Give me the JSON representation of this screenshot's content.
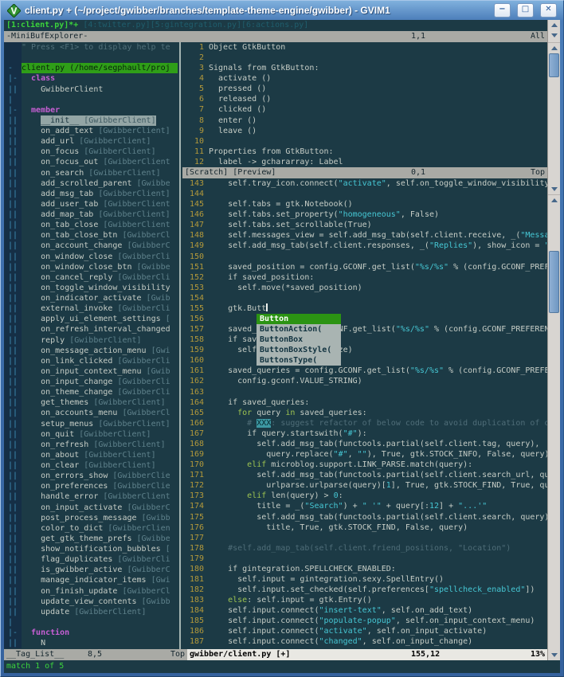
{
  "titlebar": {
    "title": "client.py + (~/project/gwibber/branches/template-theme-engine/gwibber) - GVIM1",
    "minimize": "−",
    "maximize": "□",
    "close": "✕"
  },
  "colors": {
    "titlebar_blue": "#3c6dab",
    "editor_bg": "#1c3a45",
    "string_cyan": "#46c7d4",
    "keyword_green": "#9dc351",
    "tag_keyword_magenta": "#c75fd4",
    "line_number_olive": "#b3993b",
    "file_highlight_green": "#2f9e18",
    "popup_selected_green": "#2b9313",
    "buffer_active_green": "#3bd33b",
    "match_message_green": "#3cd33c",
    "statusline_inactive": "#a9aaa5",
    "statusline_active": "#e9e8e3",
    "comment_dim": "#4f6d78",
    "todo_xxx_bg": "#3d98a3",
    "selected_tag_bg": "#93a5a5"
  },
  "minibuf": {
    "buffers_active": "[1:client.py]*+",
    "buffers_inactive": " [4:twitter.py][5:gintegration.py][6:actions.py]",
    "status_name": "-MiniBufExplorer-",
    "status_pos": "1,1",
    "status_scroll": "All"
  },
  "taglist": {
    "rows": [
      {
        "fold": "",
        "kind": "help",
        "text": "\" Press <F1> to display help te"
      },
      {
        "fold": "",
        "kind": "blank"
      },
      {
        "fold": "-",
        "kind": "file",
        "text": "client.py (/home/segphault/proj"
      },
      {
        "fold": "|-",
        "kind": "kw",
        "text": "  class"
      },
      {
        "fold": "||",
        "kind": "tag",
        "name": "GwibberClient",
        "suffix": ""
      },
      {
        "fold": "|",
        "kind": "blank"
      },
      {
        "fold": "|-",
        "kind": "kw",
        "text": "  member"
      },
      {
        "fold": "||",
        "kind": "sel",
        "name": "__init__",
        "suffix": " [GwibberClient]"
      },
      {
        "fold": "||",
        "kind": "tag",
        "name": "on_add_text",
        "suffix": " [GwibberClient]"
      },
      {
        "fold": "||",
        "kind": "tag",
        "name": "add_url",
        "suffix": " [GwibberClient]"
      },
      {
        "fold": "||",
        "kind": "tag",
        "name": "on_focus",
        "suffix": " [GwibberClient]"
      },
      {
        "fold": "||",
        "kind": "tag",
        "name": "on_focus_out",
        "suffix": " [GwibberClient"
      },
      {
        "fold": "||",
        "kind": "tag",
        "name": "on_search",
        "suffix": " [GwibberClient]"
      },
      {
        "fold": "||",
        "kind": "tag",
        "name": "add_scrolled_parent",
        "suffix": " [Gwibbe"
      },
      {
        "fold": "||",
        "kind": "tag",
        "name": "add_msg_tab",
        "suffix": " [GwibberClient]"
      },
      {
        "fold": "||",
        "kind": "tag",
        "name": "add_user_tab",
        "suffix": " [GwibberClient"
      },
      {
        "fold": "||",
        "kind": "tag",
        "name": "add_map_tab",
        "suffix": " [GwibberClient]"
      },
      {
        "fold": "||",
        "kind": "tag",
        "name": "on_tab_close",
        "suffix": " [GwibberClient"
      },
      {
        "fold": "||",
        "kind": "tag",
        "name": "on_tab_close_btn",
        "suffix": " [GwibberCl"
      },
      {
        "fold": "||",
        "kind": "tag",
        "name": "on_account_change",
        "suffix": " [GwibberC"
      },
      {
        "fold": "||",
        "kind": "tag",
        "name": "on_window_close",
        "suffix": " [GwibberCli"
      },
      {
        "fold": "||",
        "kind": "tag",
        "name": "on_window_close_btn",
        "suffix": " [Gwibbe"
      },
      {
        "fold": "||",
        "kind": "tag",
        "name": "on_cancel_reply",
        "suffix": " [GwibberCli"
      },
      {
        "fold": "||",
        "kind": "tag",
        "name": "on_toggle_window_visibility",
        "suffix": ""
      },
      {
        "fold": "||",
        "kind": "tag",
        "name": "on_indicator_activate",
        "suffix": " [Gwib"
      },
      {
        "fold": "||",
        "kind": "tag",
        "name": "external_invoke",
        "suffix": " [GwibberCli"
      },
      {
        "fold": "||",
        "kind": "tag",
        "name": "apply_ui_element_settings",
        "suffix": " ["
      },
      {
        "fold": "||",
        "kind": "tag",
        "name": "on_refresh_interval_changed",
        "suffix": ""
      },
      {
        "fold": "||",
        "kind": "tag",
        "name": "reply",
        "suffix": " [GwibberClient]"
      },
      {
        "fold": "||",
        "kind": "tag",
        "name": "on_message_action_menu",
        "suffix": " [Gwi"
      },
      {
        "fold": "||",
        "kind": "tag",
        "name": "on_link_clicked",
        "suffix": " [GwibberCli"
      },
      {
        "fold": "||",
        "kind": "tag",
        "name": "on_input_context_menu",
        "suffix": " [Gwib"
      },
      {
        "fold": "||",
        "kind": "tag",
        "name": "on_input_change",
        "suffix": " [GwibberCli"
      },
      {
        "fold": "||",
        "kind": "tag",
        "name": "on_theme_change",
        "suffix": " [GwibberCli"
      },
      {
        "fold": "||",
        "kind": "tag",
        "name": "get_themes",
        "suffix": " [GwibberClient]"
      },
      {
        "fold": "||",
        "kind": "tag",
        "name": "on_accounts_menu",
        "suffix": " [GwibberCl"
      },
      {
        "fold": "||",
        "kind": "tag",
        "name": "setup_menus",
        "suffix": " [GwibberClient]"
      },
      {
        "fold": "||",
        "kind": "tag",
        "name": "on_quit",
        "suffix": " [GwibberClient]"
      },
      {
        "fold": "||",
        "kind": "tag",
        "name": "on_refresh",
        "suffix": " [GwibberClient]"
      },
      {
        "fold": "||",
        "kind": "tag",
        "name": "on_about",
        "suffix": " [GwibberClient]"
      },
      {
        "fold": "||",
        "kind": "tag",
        "name": "on_clear",
        "suffix": " [GwibberClient]"
      },
      {
        "fold": "||",
        "kind": "tag",
        "name": "on_errors_show",
        "suffix": " [GwibberClie"
      },
      {
        "fold": "||",
        "kind": "tag",
        "name": "on_preferences",
        "suffix": " [GwibberClie"
      },
      {
        "fold": "||",
        "kind": "tag",
        "name": "handle_error",
        "suffix": " [GwibberClient"
      },
      {
        "fold": "||",
        "kind": "tag",
        "name": "on_input_activate",
        "suffix": " [GwibberC"
      },
      {
        "fold": "||",
        "kind": "tag",
        "name": "post_process_message",
        "suffix": " [Gwibb"
      },
      {
        "fold": "||",
        "kind": "tag",
        "name": "color_to_dict",
        "suffix": " [GwibberClien"
      },
      {
        "fold": "||",
        "kind": "tag",
        "name": "get_gtk_theme_prefs",
        "suffix": " [Gwibbe"
      },
      {
        "fold": "||",
        "kind": "tag",
        "name": "show_notification_bubbles",
        "suffix": " ["
      },
      {
        "fold": "||",
        "kind": "tag",
        "name": "flag_duplicates",
        "suffix": " [GwibberCli"
      },
      {
        "fold": "||",
        "kind": "tag",
        "name": "is_gwibber_active",
        "suffix": " [GwibberC"
      },
      {
        "fold": "||",
        "kind": "tag",
        "name": "manage_indicator_items",
        "suffix": " [Gwi"
      },
      {
        "fold": "||",
        "kind": "tag",
        "name": "on_finish_update",
        "suffix": " [GwibberCl"
      },
      {
        "fold": "||",
        "kind": "tag",
        "name": "update_view_contents",
        "suffix": " [Gwibb"
      },
      {
        "fold": "||",
        "kind": "tag",
        "name": "update",
        "suffix": " [GwibberClient]"
      },
      {
        "fold": "|",
        "kind": "blank"
      },
      {
        "fold": "|-",
        "kind": "kw",
        "text": "  function"
      },
      {
        "fold": "||",
        "kind": "tag",
        "name": "N",
        "suffix": ""
      }
    ],
    "status_name": "__Tag_List__",
    "status_pos": "8,5",
    "status_scroll": "Top"
  },
  "preview": {
    "lines": [
      {
        "n": "1",
        "text": "Object GtkButton"
      },
      {
        "n": "2",
        "text": ""
      },
      {
        "n": "3",
        "text": "Signals from GtkButton:"
      },
      {
        "n": "4",
        "text": "  activate ()"
      },
      {
        "n": "5",
        "text": "  pressed ()"
      },
      {
        "n": "6",
        "text": "  released ()"
      },
      {
        "n": "7",
        "text": "  clicked ()"
      },
      {
        "n": "8",
        "text": "  enter ()"
      },
      {
        "n": "9",
        "text": "  leave ()"
      },
      {
        "n": "10",
        "text": ""
      },
      {
        "n": "11",
        "text": "Properties from GtkButton:"
      },
      {
        "n": "12",
        "text": "  label -> gchararray: Label"
      }
    ],
    "status_name": "[Scratch] [Preview]",
    "status_pos": "0,1",
    "status_scroll": "Top"
  },
  "editor": {
    "lines": [
      {
        "n": "143",
        "segs": [
          [
            "    self.tray_icon.connect(",
            "n"
          ],
          [
            "\"activate\"",
            "s"
          ],
          [
            ", self.on_toggle_window_visibility",
            "n"
          ]
        ]
      },
      {
        "n": "144",
        "segs": []
      },
      {
        "n": "145",
        "segs": [
          [
            "    self.tabs = gtk.Notebook()",
            "n"
          ]
        ]
      },
      {
        "n": "146",
        "segs": [
          [
            "    self.tabs.set_property(",
            "n"
          ],
          [
            "\"homogeneous\"",
            "s"
          ],
          [
            ", False)",
            "n"
          ]
        ]
      },
      {
        "n": "147",
        "segs": [
          [
            "    self.tabs.set_scrollable(True)",
            "n"
          ]
        ]
      },
      {
        "n": "148",
        "segs": [
          [
            "    self.messages_view = self.add_msg_tab(self.client.receive, _(",
            "n"
          ],
          [
            "\"Messa",
            "s"
          ]
        ]
      },
      {
        "n": "149",
        "segs": [
          [
            "    self.add_msg_tab(self.client.responses, _(",
            "n"
          ],
          [
            "\"Replies\"",
            "s"
          ],
          [
            "), show_icon = ",
            "n"
          ],
          [
            "\"",
            "s"
          ]
        ]
      },
      {
        "n": "150",
        "segs": []
      },
      {
        "n": "151",
        "segs": [
          [
            "    saved_position = config.GCONF.get_list(",
            "n"
          ],
          [
            "\"%s/%s\"",
            "s"
          ],
          [
            " % (config.GCONF_PREF",
            "n"
          ]
        ]
      },
      {
        "n": "152",
        "segs": [
          [
            "    if saved_position:",
            "n"
          ]
        ]
      },
      {
        "n": "153",
        "segs": [
          [
            "      self.move(*saved_position)",
            "n"
          ]
        ]
      },
      {
        "n": "154",
        "segs": []
      },
      {
        "n": "155",
        "segs": [
          [
            "    gtk.Butt",
            "n"
          ]
        ],
        "cursor": true
      },
      {
        "n": "156",
        "segs": []
      },
      {
        "n": "157",
        "segs": [
          [
            "    saved_",
            "n"
          ],
          [
            "                 ",
            "n"
          ],
          [
            "NF.get_list(",
            "n"
          ],
          [
            "\"%s/%s\"",
            "s"
          ],
          [
            " % (config.GCONF_PREFEREN",
            "n"
          ]
        ]
      },
      {
        "n": "158",
        "segs": [
          [
            "    if sav",
            "n"
          ]
        ]
      },
      {
        "n": "159",
        "segs": [
          [
            "      self",
            "n"
          ],
          [
            "                 ",
            "n"
          ],
          [
            "ze)",
            "n"
          ]
        ]
      },
      {
        "n": "160",
        "segs": []
      },
      {
        "n": "161",
        "segs": [
          [
            "    saved_queries = config.GCONF.get_list(",
            "n"
          ],
          [
            "\"%s/%s\"",
            "s"
          ],
          [
            " % (config.GCONF_PREFE",
            "n"
          ]
        ]
      },
      {
        "n": "162",
        "segs": [
          [
            "      config.gconf.VALUE_STRING)",
            "n"
          ]
        ]
      },
      {
        "n": "163",
        "segs": []
      },
      {
        "n": "164",
        "segs": [
          [
            "    if saved_queries:",
            "n"
          ]
        ]
      },
      {
        "n": "165",
        "segs": [
          [
            "      ",
            "n"
          ],
          [
            "for",
            "k"
          ],
          [
            " query ",
            "n"
          ],
          [
            "in",
            "k"
          ],
          [
            " saved_queries:",
            "n"
          ]
        ]
      },
      {
        "n": "166",
        "segs": [
          [
            "        ",
            "n"
          ],
          [
            "# ",
            "c"
          ],
          [
            "XXX",
            "x"
          ],
          [
            ": suggest refactor of below code to avoid duplication of o",
            "c"
          ]
        ]
      },
      {
        "n": "167",
        "segs": [
          [
            "        if query.startswith(",
            "n"
          ],
          [
            "\"#\"",
            "s"
          ],
          [
            "):",
            "n"
          ]
        ]
      },
      {
        "n": "168",
        "segs": [
          [
            "          self.add_msg_tab(functools.partial(self.client.tag, query),",
            "n"
          ]
        ]
      },
      {
        "n": "169",
        "segs": [
          [
            "            query.replace(",
            "n"
          ],
          [
            "\"#\"",
            "s"
          ],
          [
            ", ",
            "n"
          ],
          [
            "\"\"",
            "s"
          ],
          [
            "), True, gtk.STOCK_INFO, False, query)",
            "n"
          ]
        ]
      },
      {
        "n": "170",
        "segs": [
          [
            "        ",
            "n"
          ],
          [
            "elif",
            "k"
          ],
          [
            " microblog.support.LINK_PARSE.match(query):",
            "n"
          ]
        ]
      },
      {
        "n": "171",
        "segs": [
          [
            "          self.add_msg_tab(functools.partial(self.client.search_url, qu",
            "n"
          ]
        ]
      },
      {
        "n": "172",
        "segs": [
          [
            "            urlparse.urlparse(query)[",
            "n"
          ],
          [
            "1",
            "s"
          ],
          [
            "], True, gtk.STOCK_FIND, True, qu",
            "n"
          ]
        ]
      },
      {
        "n": "173",
        "segs": [
          [
            "        ",
            "n"
          ],
          [
            "elif",
            "k"
          ],
          [
            " len(query) > ",
            "n"
          ],
          [
            "0",
            "s"
          ],
          [
            ":",
            "n"
          ]
        ]
      },
      {
        "n": "174",
        "segs": [
          [
            "          title = _(",
            "n"
          ],
          [
            "\"Search\"",
            "s"
          ],
          [
            ") + ",
            "n"
          ],
          [
            "\" '\"",
            "s"
          ],
          [
            " + query[:",
            "n"
          ],
          [
            "12",
            "s"
          ],
          [
            "] + ",
            "n"
          ],
          [
            "\"...'\"",
            "s"
          ]
        ]
      },
      {
        "n": "175",
        "segs": [
          [
            "          self.add_msg_tab(functools.partial(self.client.search, query)",
            "n"
          ]
        ]
      },
      {
        "n": "176",
        "segs": [
          [
            "            title, True, gtk.STOCK_FIND, False, query)",
            "n"
          ]
        ]
      },
      {
        "n": "177",
        "segs": []
      },
      {
        "n": "178",
        "segs": [
          [
            "    #self.add_map_tab(self.client.friend_positions, \"Location\")",
            "c"
          ]
        ]
      },
      {
        "n": "179",
        "segs": []
      },
      {
        "n": "180",
        "segs": [
          [
            "    if gintegration.SPELLCHECK_ENABLED:",
            "n"
          ]
        ]
      },
      {
        "n": "181",
        "segs": [
          [
            "      self.input = gintegration.sexy.SpellEntry()",
            "n"
          ]
        ]
      },
      {
        "n": "182",
        "segs": [
          [
            "      self.input.set_checked(self.preferences[",
            "n"
          ],
          [
            "\"spellcheck_enabled\"",
            "s"
          ],
          [
            "])",
            "n"
          ]
        ]
      },
      {
        "n": "183",
        "segs": [
          [
            "    ",
            "n"
          ],
          [
            "else",
            "k"
          ],
          [
            ": self.input = gtk.Entry()",
            "n"
          ]
        ]
      },
      {
        "n": "184",
        "segs": [
          [
            "    self.input.connect(",
            "n"
          ],
          [
            "\"insert-text\"",
            "s"
          ],
          [
            ", self.on_add_text)",
            "n"
          ]
        ]
      },
      {
        "n": "185",
        "segs": [
          [
            "    self.input.connect(",
            "n"
          ],
          [
            "\"populate-popup\"",
            "s"
          ],
          [
            ", self.on_input_context_menu)",
            "n"
          ]
        ]
      },
      {
        "n": "186",
        "segs": [
          [
            "    self.input.connect(",
            "n"
          ],
          [
            "\"activate\"",
            "s"
          ],
          [
            ", self.on_input_activate)",
            "n"
          ]
        ]
      },
      {
        "n": "187",
        "segs": [
          [
            "    self.input.connect(",
            "n"
          ],
          [
            "\"changed\"",
            "s"
          ],
          [
            ", self.on_input_change)",
            "n"
          ]
        ]
      }
    ],
    "popup": {
      "items": [
        {
          "label": "Button",
          "selected": true
        },
        {
          "label": "ButtonAction("
        },
        {
          "label": "ButtonBox"
        },
        {
          "label": "ButtonBoxStyle("
        },
        {
          "label": "ButtonsType("
        }
      ]
    },
    "status_name": "gwibber/client.py [+]",
    "status_pos": "155,12",
    "status_scroll": "13%"
  },
  "cmdline": "match 1 of 5"
}
